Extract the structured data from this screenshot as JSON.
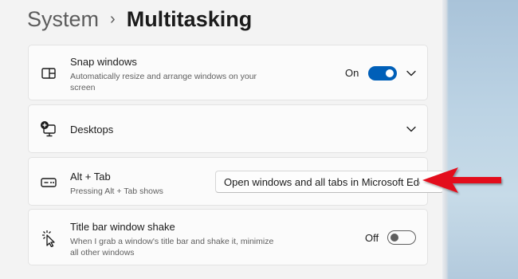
{
  "breadcrumb": {
    "parent": "System",
    "separator": "›",
    "current": "Multitasking"
  },
  "settings": {
    "snap": {
      "title": "Snap windows",
      "subtitle_line1": "Automatically resize and arrange windows on your",
      "subtitle_line2": "screen",
      "state_label": "On",
      "toggle_on": true,
      "icon": "snap-layout-icon"
    },
    "desktops": {
      "title": "Desktops",
      "icon": "virtual-desktop-icon"
    },
    "alttab": {
      "title": "Alt + Tab",
      "subtitle": "Pressing Alt + Tab shows",
      "selected_option": "Open windows and all tabs in Microsoft Edge",
      "icon": "keyboard-alt-tab-icon"
    },
    "shake": {
      "title": "Title bar window shake",
      "subtitle_line1": "When I grab a window's title bar and shake it, minimize",
      "subtitle_line2": "all other windows",
      "state_label": "Off",
      "toggle_on": false,
      "icon": "cursor-shake-icon"
    }
  },
  "colors": {
    "accent": "#005fb8",
    "annotation_arrow": "#e3111b",
    "page_background": "#f3f3f3",
    "card_background": "#fbfbfb"
  }
}
